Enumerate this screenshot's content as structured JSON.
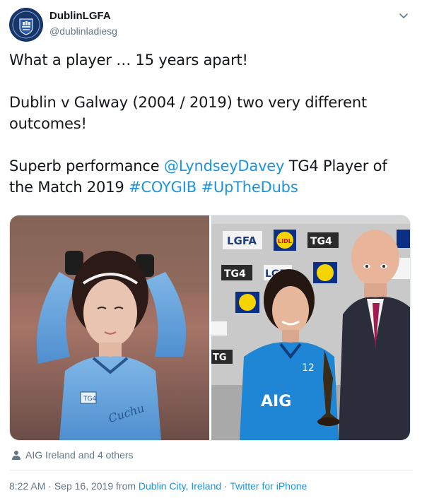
{
  "user": {
    "display_name": "DublinLGFA",
    "handle": "@dublinladiesg"
  },
  "tweet": {
    "line1": "What a player … 15 years apart!",
    "line2": "Dublin v Galway (2004 / 2019) two very different outcomes!",
    "line3_prefix": "Superb performance ",
    "mention": "@LyndseyDavey",
    "line3_middle": " TG4 Player of the Match 2019 ",
    "hashtag1": "#COYGIB",
    "hashtag2": "#UpTheDubs"
  },
  "media": {
    "left_photo": "Player in blue Dublin jersey with hands on head (2004)",
    "right_photo": "Player holding TG4 award with man in suit (2019)",
    "right_signage": [
      "LGFA",
      "LIDL",
      "TG4"
    ]
  },
  "likers": {
    "text": "AIG Ireland and 4 others"
  },
  "meta": {
    "time": "8:22 AM",
    "date": "Sep 16, 2019",
    "from_label": "from",
    "location": "Dublin City, Ireland",
    "separator": "·",
    "source": "Twitter for iPhone"
  },
  "colors": {
    "link": "#1b95e0",
    "secondary_text": "#657786",
    "primary_text": "#14171a"
  }
}
